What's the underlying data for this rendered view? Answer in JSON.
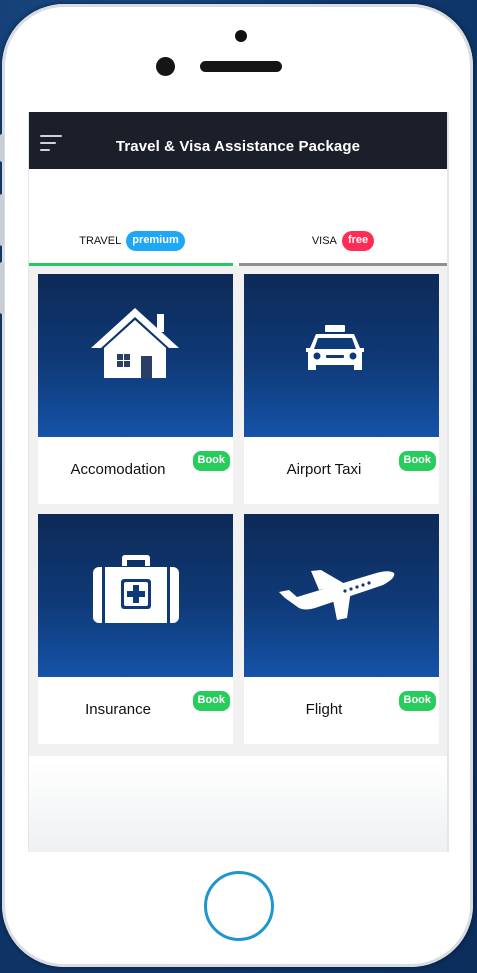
{
  "header": {
    "title": "Travel & Visa Assistance Package",
    "menu_icon": "hamburger-menu-icon"
  },
  "tabs": [
    {
      "label": "TRAVEL",
      "badge": "premium",
      "badge_color": "#1ea7f5",
      "active": true,
      "underline_color": "#27c864"
    },
    {
      "label": "VISA",
      "badge": "free",
      "badge_color": "#ff2d55",
      "active": false,
      "underline_color": "#8e9094"
    }
  ],
  "services": [
    {
      "name": "Accomodation",
      "icon": "house-icon",
      "action": "Book"
    },
    {
      "name": "Airport Taxi",
      "icon": "taxi-icon",
      "action": "Book"
    },
    {
      "name": "Insurance",
      "icon": "medical-kit-icon",
      "action": "Book"
    },
    {
      "name": "Flight",
      "icon": "airplane-icon",
      "action": "Book"
    }
  ],
  "colors": {
    "topbar": "#1b1f2a",
    "card_gradient_top": "#0d2a57",
    "card_gradient_bottom": "#1553a8",
    "book_green": "#27cc5c",
    "home_button_ring": "#1f97ce"
  }
}
